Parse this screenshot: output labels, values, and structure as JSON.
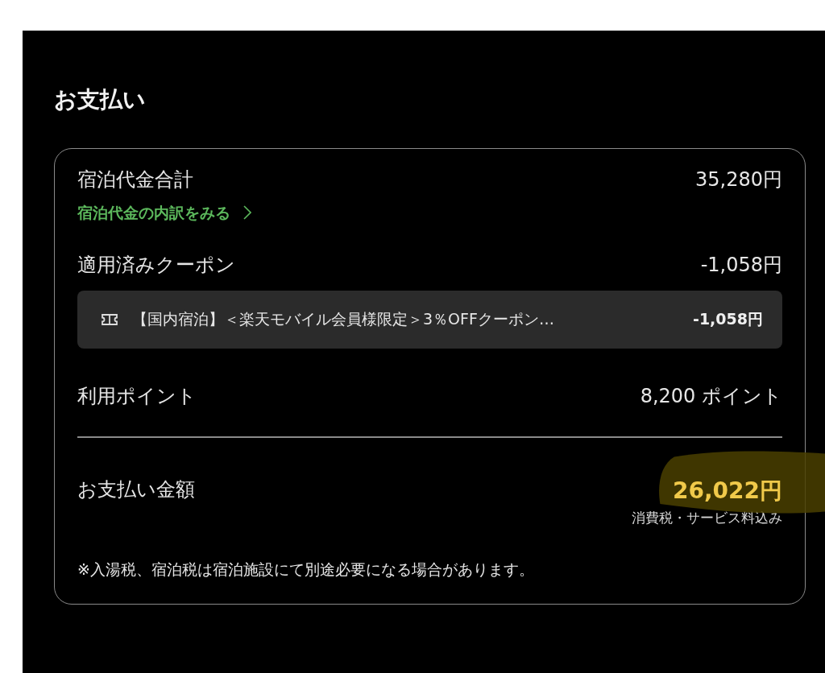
{
  "title": "お支払い",
  "room_total": {
    "label": "宿泊代金合計",
    "amount": "35,280円",
    "link": "宿泊代金の内訳をみる"
  },
  "coupon": {
    "label": "適用済みクーポン",
    "amount": "-1,058円",
    "items": [
      {
        "name": "【国内宿泊】＜楽天モバイル会員様限定＞3％OFFクーポン…",
        "amount": "-1,058円"
      }
    ]
  },
  "points": {
    "label": "利用ポイント",
    "amount": "8,200 ポイント"
  },
  "payment": {
    "label": "お支払い金額",
    "amount": "26,022円",
    "note": "消費税・サービス料込み"
  },
  "footnote": "※入湯税、宿泊税は宿泊施設にて別途必要になる場合があります。"
}
